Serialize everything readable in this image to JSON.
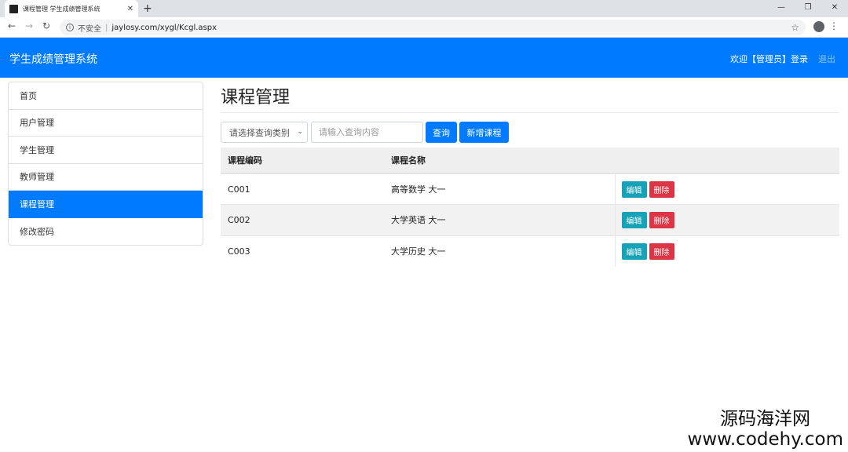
{
  "browser": {
    "tab_title": "课程管理 学生成绩管理系统",
    "tab_close": "✕",
    "new_tab": "+",
    "min": "—",
    "max": "❐",
    "close": "✕",
    "back": "←",
    "forward": "→",
    "reload": "↻",
    "info": "i",
    "insecure_label": "不安全",
    "separator": "|",
    "url": "jaylosy.com/xygl/Kcgl.aspx",
    "star": "☆",
    "menu": "⋮"
  },
  "navbar": {
    "brand": "学生成绩管理系统",
    "welcome": "欢迎【管理员】登录",
    "logout": "退出",
    "color": "#007bff"
  },
  "sidebar": {
    "items": [
      {
        "label": "首页"
      },
      {
        "label": "用户管理"
      },
      {
        "label": "学生管理"
      },
      {
        "label": "教师管理"
      },
      {
        "label": "课程管理",
        "active": true
      },
      {
        "label": "修改密码"
      }
    ]
  },
  "main": {
    "title": "课程管理",
    "search": {
      "select_value": "请选择查询类别",
      "caret": "⌄",
      "input_placeholder": "请输入查询内容",
      "query_label": "查询",
      "add_label": "新增课程"
    },
    "table": {
      "headers": [
        "课程编码",
        "课程名称",
        ""
      ],
      "rows": [
        {
          "code": "C001",
          "name": "高等数学 大一"
        },
        {
          "code": "C002",
          "name": "大学英语 大一"
        },
        {
          "code": "C003",
          "name": "大学历史 大一"
        }
      ],
      "edit_label": "编辑",
      "delete_label": "删除"
    }
  },
  "watermark": {
    "line1": "源码海洋网",
    "line2": "www.codehy.com"
  }
}
